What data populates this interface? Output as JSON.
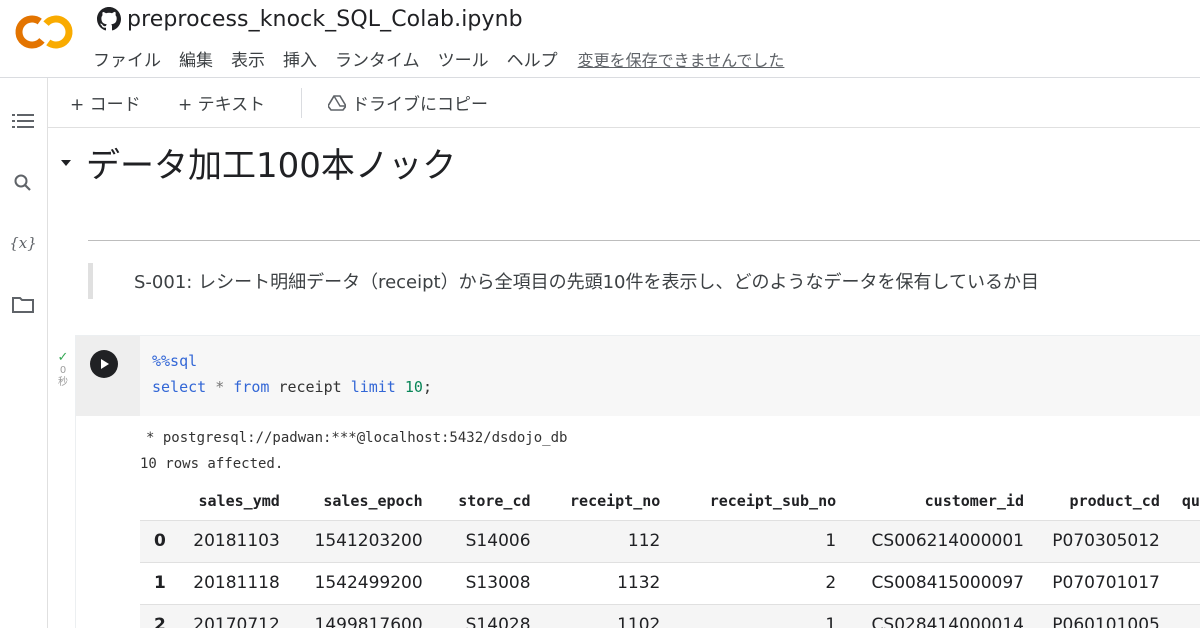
{
  "app": {
    "notebook_title": "preprocess_knock_SQL_Colab.ipynb",
    "logo_text": "CO",
    "menu": [
      "ファイル",
      "編集",
      "表示",
      "挿入",
      "ランタイム",
      "ツール",
      "ヘルプ"
    ],
    "save_warning": "変更を保存できませんでした"
  },
  "toolbar": {
    "add_code": "+ コード",
    "add_text": "+ テキスト",
    "copy_to_drive": "ドライブにコピー"
  },
  "notebook": {
    "heading": "データ加工100本ノック",
    "question": "S-001: レシート明細データ（receipt）から全項目の先頭10件を表示し、どのようなデータを保有しているか目"
  },
  "cell": {
    "exec_status": "✓",
    "exec_time_num": "0",
    "exec_time_unit": "秒",
    "code_line1": "%%sql",
    "code_tokens": {
      "select": "select",
      "star": "*",
      "from": "from",
      "table": "receipt",
      "limit": "limit",
      "num": "10",
      "end": ";"
    },
    "output_line1": "* postgresql://padwan:***@localhost:5432/dsdojo_db",
    "output_line2": "10 rows affected."
  },
  "table": {
    "columns": [
      "",
      "sales_ymd",
      "sales_epoch",
      "store_cd",
      "receipt_no",
      "receipt_sub_no",
      "customer_id",
      "product_cd",
      "qu"
    ],
    "rows": [
      [
        "0",
        "20181103",
        "1541203200",
        "S14006",
        "112",
        "1",
        "CS006214000001",
        "P070305012"
      ],
      [
        "1",
        "20181118",
        "1542499200",
        "S13008",
        "1132",
        "2",
        "CS008415000097",
        "P070701017"
      ],
      [
        "2",
        "20170712",
        "1499817600",
        "S14028",
        "1102",
        "1",
        "CS028414000014",
        "P060101005"
      ]
    ]
  },
  "colors": {
    "logo_orange": "#F9AB00",
    "logo_orange_dark": "#E37400",
    "check_green": "#34A853",
    "keyword_blue": "#3367D6"
  }
}
